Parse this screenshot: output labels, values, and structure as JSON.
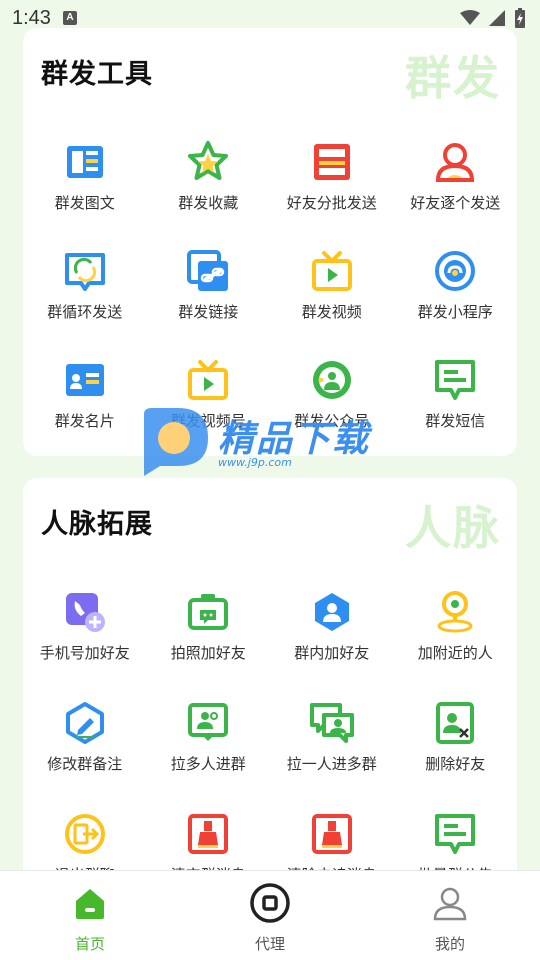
{
  "status_bar": {
    "time": "1:43",
    "notif": "A"
  },
  "sections": [
    {
      "title": "群发工具",
      "watermark": "群发",
      "tools": [
        {
          "label": "群发图文",
          "icon": "image-text-icon"
        },
        {
          "label": "群发收藏",
          "icon": "star-icon"
        },
        {
          "label": "好友分批发送",
          "icon": "batch-send-icon"
        },
        {
          "label": "好友逐个发送",
          "icon": "person-icon"
        },
        {
          "label": "群循环发送",
          "icon": "loop-icon"
        },
        {
          "label": "群发链接",
          "icon": "link-icon"
        },
        {
          "label": "群发视频",
          "icon": "tv-icon"
        },
        {
          "label": "群发小程序",
          "icon": "mini-program-icon"
        },
        {
          "label": "群发名片",
          "icon": "card-icon"
        },
        {
          "label": "群发视频号",
          "icon": "tv-icon"
        },
        {
          "label": "群发公众号",
          "icon": "official-account-icon"
        },
        {
          "label": "群发短信",
          "icon": "sms-icon"
        }
      ]
    },
    {
      "title": "人脉拓展",
      "watermark": "人脉",
      "tools": [
        {
          "label": "手机号加好友",
          "icon": "phone-add-icon"
        },
        {
          "label": "拍照加好友",
          "icon": "camera-icon"
        },
        {
          "label": "群内加好友",
          "icon": "group-person-icon"
        },
        {
          "label": "加附近的人",
          "icon": "nearby-icon"
        },
        {
          "label": "修改群备注",
          "icon": "edit-icon"
        },
        {
          "label": "拉多人进群",
          "icon": "invite-many-icon"
        },
        {
          "label": "拉一人进多群",
          "icon": "invite-one-icon"
        },
        {
          "label": "删除好友",
          "icon": "delete-friend-icon"
        },
        {
          "label": "退出群聊",
          "icon": "exit-icon"
        },
        {
          "label": "清空群消息",
          "icon": "clean-icon"
        },
        {
          "label": "清除未读消息",
          "icon": "clean-icon"
        },
        {
          "label": "批量群公告",
          "icon": "sms-icon"
        }
      ]
    }
  ],
  "watermark_logo": {
    "text": "精品下载",
    "url": "www.j9p.com"
  },
  "nav": [
    {
      "label": "首页",
      "icon": "home-icon",
      "active": true
    },
    {
      "label": "代理",
      "icon": "agent-icon",
      "active": false
    },
    {
      "label": "我的",
      "icon": "profile-icon",
      "active": false
    }
  ],
  "colors": {
    "accent": "#47b82b",
    "background": "#eef9ea"
  }
}
